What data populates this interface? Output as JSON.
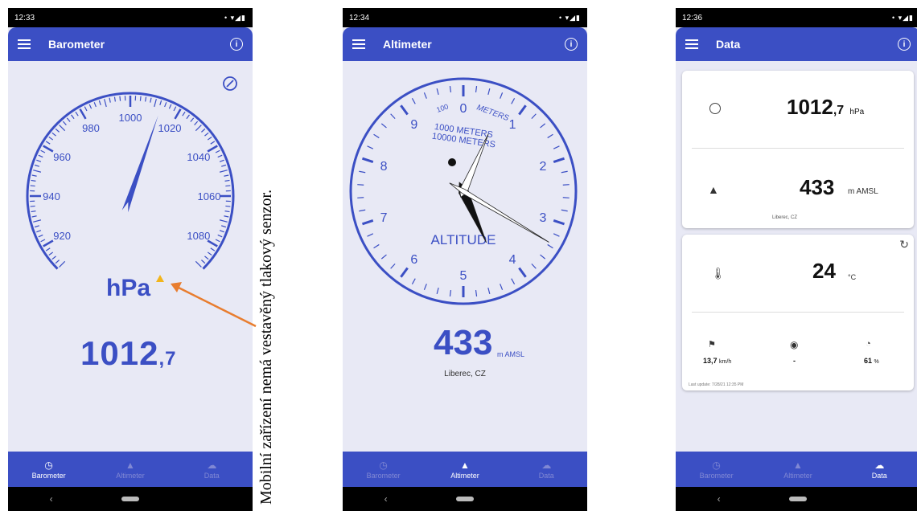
{
  "annotation": "Mobilní zařízení nemá vestavěný tlakový senzor.",
  "colors": {
    "primary": "#3b4fc4",
    "background": "#e8e9f5",
    "arrow": "#e87d2f",
    "warning": "#f2b51b"
  },
  "nav_labels": {
    "barometer": "Barometer",
    "altimeter": "Altimeter",
    "data": "Data"
  },
  "screen1": {
    "time": "12:33",
    "title": "Barometer",
    "gauge_labels": [
      "920",
      "940",
      "960",
      "980",
      "1000",
      "1020",
      "1040",
      "1060",
      "1080"
    ],
    "needle_value": 1012.7,
    "unit": "hPa",
    "value_int": "1012",
    "value_dec": ",7",
    "icons": [
      "menu-icon",
      "info-icon",
      "calibrate-icon",
      "warning-icon"
    ]
  },
  "screen2": {
    "time": "12:34",
    "title": "Altimeter",
    "dial_numbers": [
      "0",
      "1",
      "2",
      "3",
      "4",
      "5",
      "6",
      "7",
      "8",
      "9"
    ],
    "dial_small": "100",
    "meters_label": "METERS",
    "thousand_label": "1000 METERS",
    "tenthousand_label": "10000 METERS",
    "altitude_label": "ALTITUDE",
    "altitude_value": 433,
    "value": "433",
    "unit": "m AMSL",
    "location": "Liberec, CZ"
  },
  "screen3": {
    "time": "12:36",
    "title": "Data",
    "pressure_int": "1012",
    "pressure_dec": ",7",
    "pressure_unit": "hPa",
    "altitude": "433",
    "altitude_unit": "m AMSL",
    "location": "Liberec, CZ",
    "temperature": "24",
    "temperature_unit": "°C",
    "wind": "13,7",
    "wind_unit": "km/h",
    "visibility": "-",
    "humidity": "61",
    "humidity_unit": "%",
    "last_update": "Last update: 7/28/21 12:35 PM"
  }
}
